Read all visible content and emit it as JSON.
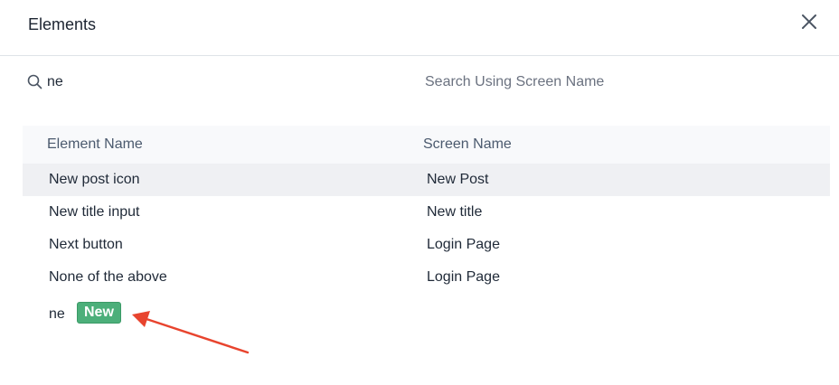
{
  "dialog": {
    "title": "Elements"
  },
  "search": {
    "query": "ne",
    "screen_placeholder": "Search Using Screen Name"
  },
  "table": {
    "headers": {
      "element_name": "Element Name",
      "screen_name": "Screen Name"
    },
    "rows": [
      {
        "element": "New post icon",
        "screen": "New Post"
      },
      {
        "element": "New title input",
        "screen": "New title"
      },
      {
        "element": "Next button",
        "screen": "Login Page"
      },
      {
        "element": "None of the above",
        "screen": "Login Page"
      }
    ]
  },
  "new_item": {
    "name": "ne",
    "badge": "New"
  },
  "colors": {
    "badge": "#4caf7a",
    "arrow": "#e8442e",
    "highlight_row": "#eff0f3"
  },
  "icons": {
    "close": "close-icon",
    "search": "search-icon"
  }
}
